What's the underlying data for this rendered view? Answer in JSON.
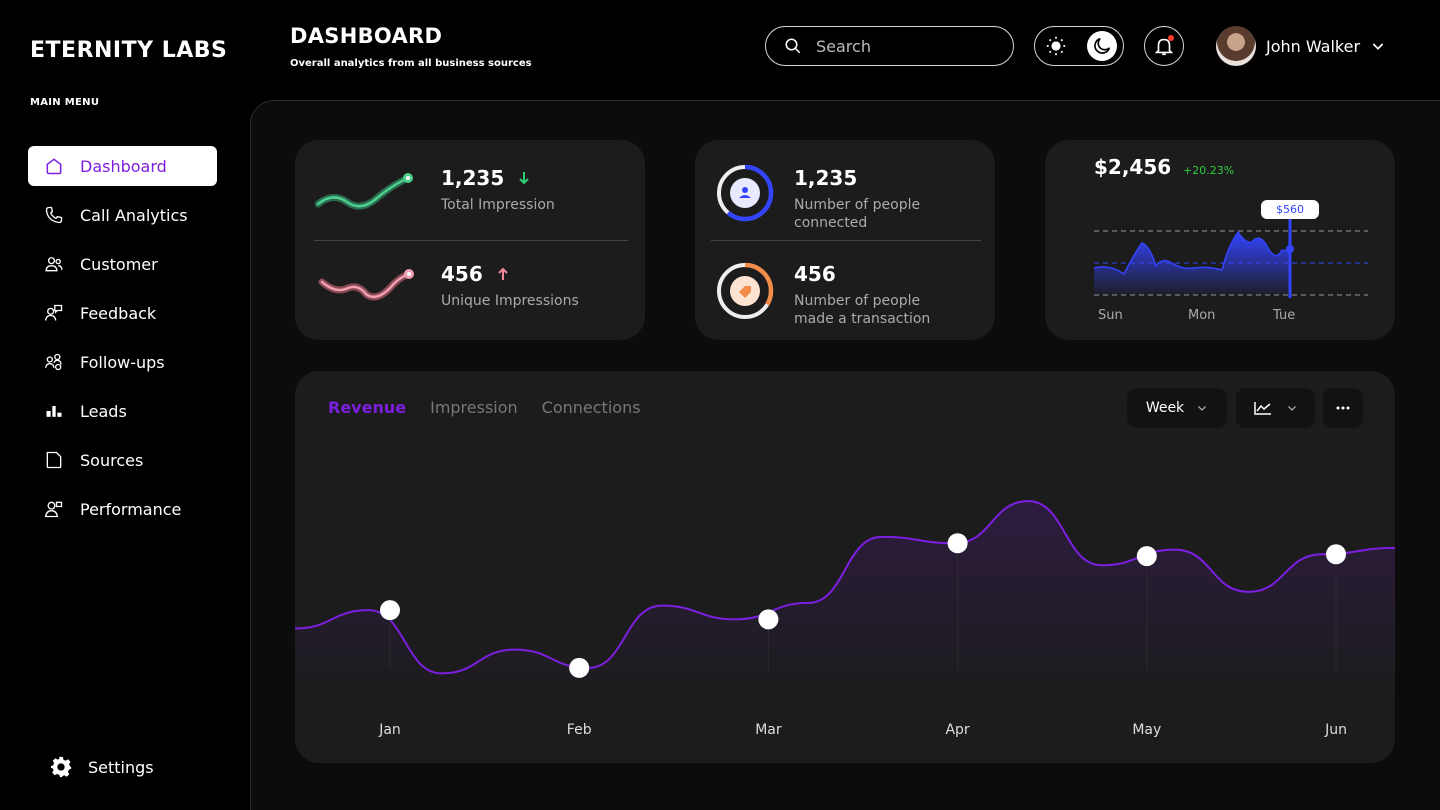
{
  "brand": "ETERNITY LABS",
  "menu_label": "MAIN MENU",
  "nav": [
    {
      "label": "Dashboard"
    },
    {
      "label": "Call Analytics"
    },
    {
      "label": "Customer"
    },
    {
      "label": "Feedback"
    },
    {
      "label": "Follow-ups"
    },
    {
      "label": "Leads"
    },
    {
      "label": "Sources"
    },
    {
      "label": "Performance"
    }
  ],
  "settings_label": "Settings",
  "header": {
    "title": "DASHBOARD",
    "subtitle": "Overall analytics from all business sources",
    "search_placeholder": "Search",
    "user_name": "John Walker"
  },
  "impressions": {
    "total_value": "1,235",
    "total_label": "Total Impression",
    "unique_value": "456",
    "unique_label": "Unique Impressions"
  },
  "people": {
    "connected_value": "1,235",
    "connected_label": "Number of people connected",
    "transaction_value": "456",
    "transaction_label": "Number of people made a transaction"
  },
  "mini_chart": {
    "value": "$2,456",
    "change": "+20.23%",
    "tooltip": "$560",
    "days": [
      "Sun",
      "Mon",
      "Tue"
    ]
  },
  "revenue": {
    "tabs": [
      "Revenue",
      "Impression",
      "Connections"
    ],
    "range": "Week"
  },
  "colors": {
    "accent": "#7c1fe0",
    "positive": "#2ecc40",
    "mini_blue": "#3344ff"
  },
  "chart_data": {
    "type": "line",
    "title": "Revenue",
    "x": [
      "Jan",
      "Feb",
      "Mar",
      "Apr",
      "May",
      "Jun"
    ],
    "markers": [
      {
        "x": "Jan",
        "y": 158
      },
      {
        "x": "Feb",
        "y": 95
      },
      {
        "x": "Mar",
        "y": 148
      },
      {
        "x": "Apr",
        "y": 231
      },
      {
        "x": "May",
        "y": 217
      },
      {
        "x": "Jun",
        "y": 219
      }
    ],
    "series": [
      {
        "values": [
          138,
          158,
          89,
          115,
          95,
          163,
          148,
          166,
          238,
          231,
          277,
          207,
          224,
          178,
          219,
          226
        ]
      }
    ]
  }
}
